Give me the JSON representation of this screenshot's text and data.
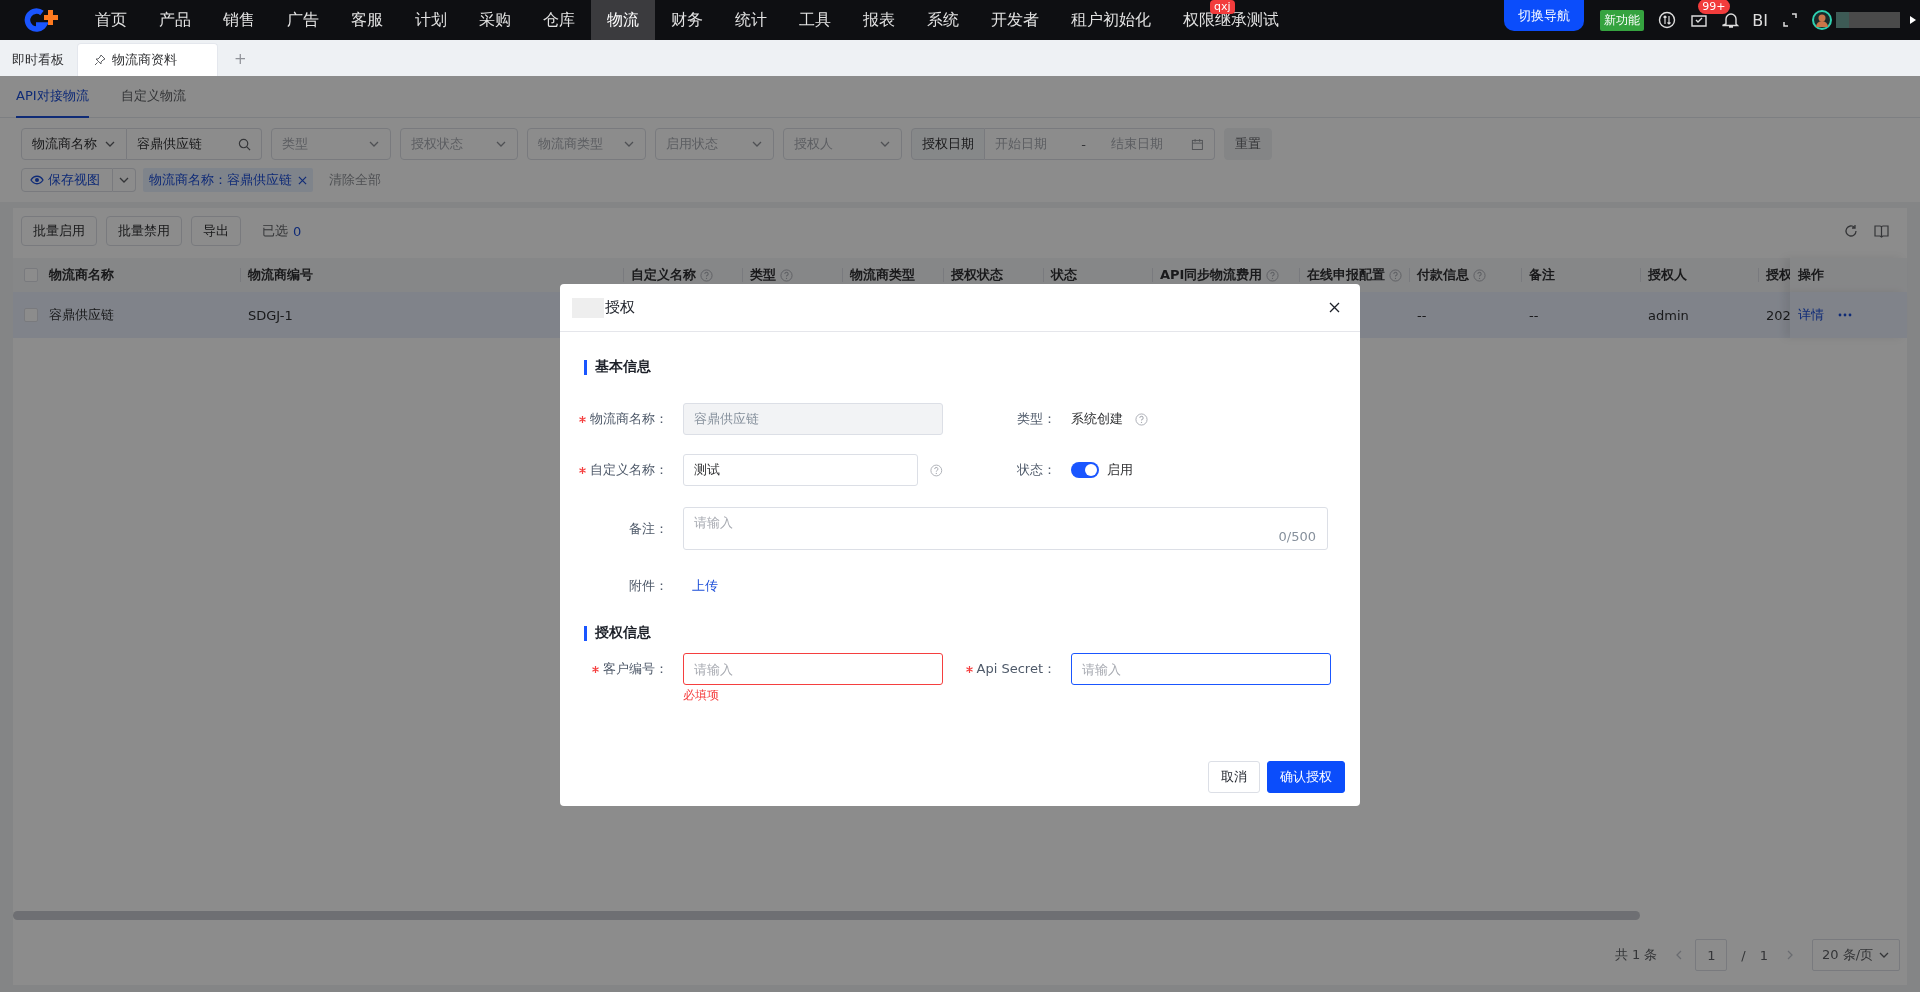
{
  "top_nav": {
    "items": [
      {
        "label": "首页",
        "selected": false
      },
      {
        "label": "产品",
        "selected": false
      },
      {
        "label": "销售",
        "selected": false
      },
      {
        "label": "广告",
        "selected": false
      },
      {
        "label": "客服",
        "selected": false
      },
      {
        "label": "计划",
        "selected": false
      },
      {
        "label": "采购",
        "selected": false
      },
      {
        "label": "仓库",
        "selected": false
      },
      {
        "label": "物流",
        "selected": true
      },
      {
        "label": "财务",
        "selected": false
      },
      {
        "label": "统计",
        "selected": false
      },
      {
        "label": "工具",
        "selected": false
      },
      {
        "label": "报表",
        "selected": false
      },
      {
        "label": "系统",
        "selected": false
      },
      {
        "label": "开发者",
        "selected": false
      },
      {
        "label": "租户初始化",
        "selected": false
      },
      {
        "label": "权限继承测试",
        "selected": false,
        "badge": "qxj"
      }
    ],
    "switch_nav": "切换导航",
    "new_feature": "新功能",
    "notification_count": "99+",
    "bi": "BI"
  },
  "page_tabs": [
    {
      "label": "即时看板",
      "selected": false,
      "pinned": false
    },
    {
      "label": "物流商资料",
      "selected": true,
      "pinned": true
    }
  ],
  "add_tab": "+",
  "sub_tabs": [
    {
      "label": "API对接物流",
      "selected": true
    },
    {
      "label": "自定义物流",
      "selected": false
    }
  ],
  "filters": {
    "search_by": "物流商名称",
    "search_value": "容鼎供应链",
    "selects": [
      {
        "placeholder": "类型"
      },
      {
        "placeholder": "授权状态"
      },
      {
        "placeholder": "物流商类型"
      },
      {
        "placeholder": "启用状态"
      },
      {
        "placeholder": "授权人"
      }
    ],
    "date_label": "授权日期",
    "start_placeholder": "开始日期",
    "separator": "-",
    "end_placeholder": "结束日期",
    "reset": "重置"
  },
  "view_bar": {
    "save_view": "保存视图",
    "active_filter": "物流商名称：容鼎供应链",
    "clear_all": "清除全部"
  },
  "toolbar": {
    "buttons": [
      "批量启用",
      "批量禁用",
      "导出"
    ],
    "selected_label": "已选",
    "selected_count": "0"
  },
  "table": {
    "header_checked": false,
    "columns": [
      {
        "label": "物流商名称",
        "help": false
      },
      {
        "label": "物流商编号",
        "help": false
      },
      {
        "label": "自定义名称",
        "help": true
      },
      {
        "label": "类型",
        "help": true
      },
      {
        "label": "物流商类型",
        "help": false
      },
      {
        "label": "授权状态",
        "help": false
      },
      {
        "label": "状态",
        "help": false
      },
      {
        "label": "API同步物流费用",
        "help": true
      },
      {
        "label": "在线申报配置",
        "help": true
      },
      {
        "label": "付款信息",
        "help": true
      },
      {
        "label": "备注",
        "help": false
      },
      {
        "label": "授权人",
        "help": false
      },
      {
        "label": "授权",
        "help": false
      },
      {
        "label": "操作",
        "help": false
      }
    ],
    "rows": [
      {
        "highlighted": true,
        "checked": false,
        "cells": [
          "容鼎供应链",
          "SDGJ-1",
          null,
          null,
          null,
          null,
          null,
          null,
          null,
          "--",
          "--",
          "admin",
          "202"
        ],
        "action": "详情"
      }
    ]
  },
  "pagination": {
    "total": "共 1 条",
    "page": "1",
    "separator": "/",
    "pages": "1",
    "page_size": "20 条/页"
  },
  "modal": {
    "title": "授权",
    "section_basic": "基本信息",
    "provider_name": {
      "label": "物流商名称：",
      "required": true,
      "value": "容鼎供应链",
      "disabled": true
    },
    "type": {
      "label": "类型：",
      "value": "系统创建"
    },
    "custom_name": {
      "label": "自定义名称：",
      "required": true,
      "value": "测试"
    },
    "status": {
      "label": "状态：",
      "on": true,
      "text": "启用"
    },
    "remark": {
      "label": "备注：",
      "placeholder": "请输入",
      "count": "0/500"
    },
    "attachment": {
      "label": "附件：",
      "link": "上传"
    },
    "section_auth": "授权信息",
    "customer_no": {
      "label": "客户编号：",
      "required": true,
      "placeholder": "请输入",
      "error": "必填项"
    },
    "api_secret": {
      "label": "Api Secret：",
      "required": true,
      "placeholder": "请输入",
      "focused": true
    },
    "buttons": [
      {
        "label": "取消",
        "kind": "default"
      },
      {
        "label": "确认授权",
        "kind": "primary"
      }
    ]
  }
}
